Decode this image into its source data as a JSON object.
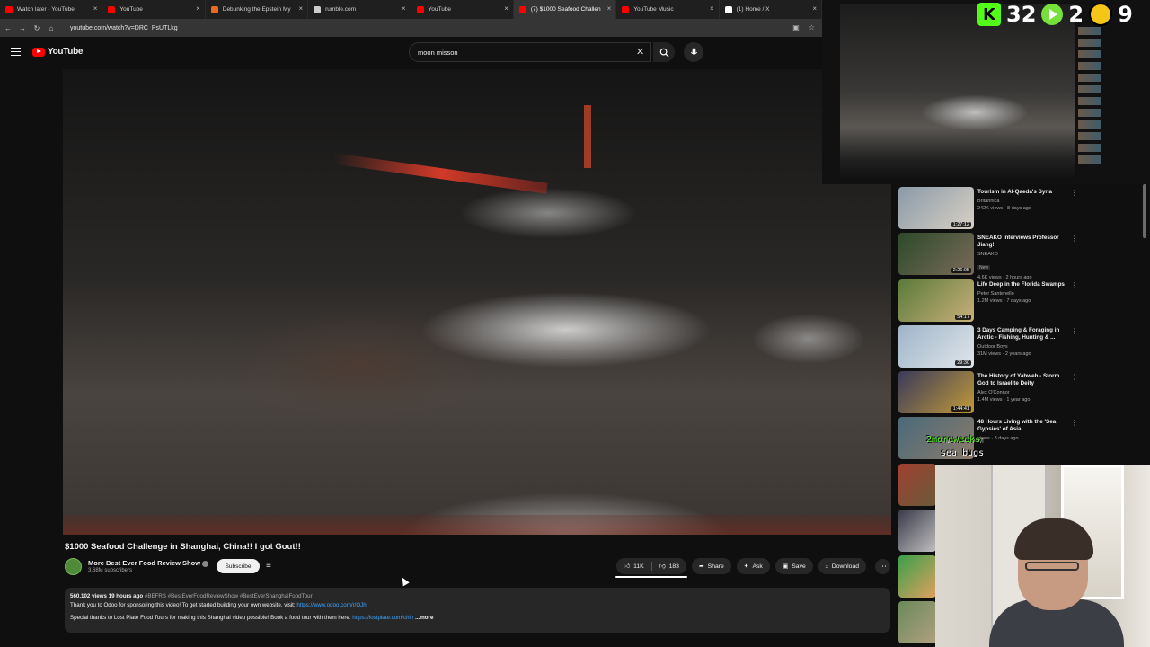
{
  "browser": {
    "tabs": [
      {
        "label": "Watch later - YouTube",
        "favicon_color": "#ff0000"
      },
      {
        "label": "YouTube",
        "favicon_color": "#ff0000"
      },
      {
        "label": "Debunking the Epstein My",
        "favicon_color": "#e8691f"
      },
      {
        "label": "rumble.com",
        "favicon_color": "#cccccc"
      },
      {
        "label": "YouTube",
        "favicon_color": "#ff0000"
      },
      {
        "label": "(7) $1000 Seafood Challen",
        "favicon_color": "#ff0000"
      },
      {
        "label": "YouTube Music",
        "favicon_color": "#ff0000"
      },
      {
        "label": "(1) Home / X",
        "favicon_color": "#ffffff"
      }
    ],
    "active_tab_index": 5,
    "url": "youtube.com/watch?v=DRC_PsUTLkg"
  },
  "masthead": {
    "logo_text": "YouTube",
    "search_value": "moon misson"
  },
  "video": {
    "title": "$1000 Seafood Challenge in Shanghai, China!! I got Gout!!",
    "channel_name": "More Best Ever Food Review Show",
    "subscribers": "3.68M subscribers",
    "subscribe_label": "Subscribe",
    "likes": "11K",
    "dislikes": "183",
    "share_label": "Share",
    "ask_label": "Ask",
    "save_label": "Save",
    "download_label": "Download",
    "description": {
      "meta": "560,102 views  19 hours ago",
      "tags": "#BEFRS #BestEverFoodReviewShow #BestEverShanghaiFoodTour",
      "line2_text": "Thank you to Odoo for sponsoring this video! To get started building your own website, visit: ",
      "line2_link": "https://www.odoo.com/r/OJh",
      "line3_text": "Special thanks to Lost Plate Food Tours for making this Shanghai video possible! Book a food tour with them here: ",
      "line3_link": "https://lostplate.com/chin",
      "more_label": "...more"
    }
  },
  "stream_overlay": {
    "kick_count": "32",
    "rumble_count": "2",
    "other_count": "9",
    "chat_user": "2moreweeks",
    "chat_time": "12:17:42 AM",
    "chat_message": "sea bugs"
  },
  "recommendations": [
    {
      "title": "Tourism in Al-Qaeda's Syria",
      "channel": "Britannica",
      "meta": "242K views · 8 days ago",
      "duration": "1:27:12",
      "colors": [
        "#8a9aa8",
        "#d8d0c4"
      ]
    },
    {
      "title": "SNEAKO Interviews Professor Jiang!",
      "channel": "SNEAKO",
      "meta": "4.6K views · 2 hours ago",
      "badge": "New",
      "duration": "2:26:05",
      "colors": [
        "#2d4a2a",
        "#7a6a5a"
      ]
    },
    {
      "title": "Life Deep in the Florida Swamps",
      "channel": "Peter Santenello",
      "meta": "1.2M views · 7 days ago",
      "duration": "54:17",
      "colors": [
        "#5b7a3a",
        "#c9b07a"
      ]
    },
    {
      "title": "3 Days Camping & Foraging in Arctic - Fishing, Hunting & ...",
      "channel": "Outdoor Boys",
      "meta": "31M views · 2 years ago",
      "duration": "29:30",
      "colors": [
        "#9fb4c8",
        "#e0e6ea"
      ]
    },
    {
      "title": "The History of Yahweh - Storm God to Israelite Deity",
      "channel": "Alex O'Connor",
      "meta": "1.4M views · 1 year ago",
      "duration": "1:44:41",
      "colors": [
        "#3a3a5a",
        "#c09a3a"
      ]
    },
    {
      "title": "48 Hours Living with the 'Sea Gypsies' of Asia",
      "channel": "",
      "meta": "views · 8 days ago",
      "duration": "",
      "colors": [
        "#4a6a7a",
        "#8a7a6a"
      ]
    }
  ],
  "extra_thumbs": [
    {
      "colors": [
        "#a04030",
        "#6a5a3a"
      ]
    },
    {
      "colors": [
        "#3a3a4a",
        "#c0c0c0"
      ]
    },
    {
      "colors": [
        "#3aa04a",
        "#e0a060"
      ]
    },
    {
      "colors": [
        "#6a8a5a",
        "#b0a080"
      ]
    }
  ]
}
